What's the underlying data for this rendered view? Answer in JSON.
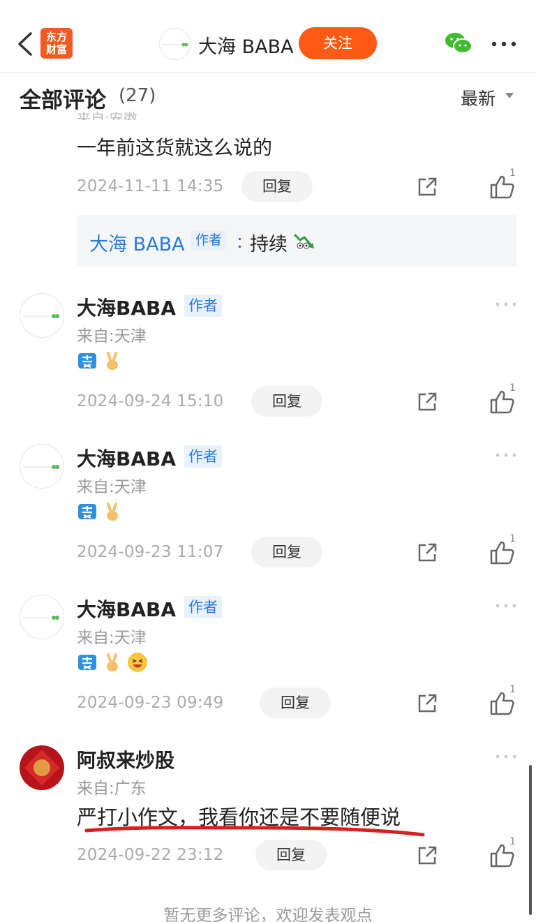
{
  "nav": {
    "logo_line1": "东方",
    "logo_line2": "财富",
    "author_name": "大海 BABA",
    "follow_label": "关注"
  },
  "header": {
    "title": "全部评论",
    "count": "(27)",
    "sort_label": "最新"
  },
  "partial_comment": {
    "source": "来自:安徽",
    "text": "一年前这货就这么说的",
    "time": "2024-11-11 14:35",
    "reply_label": "回复",
    "like_count": "1",
    "sub_reply": {
      "name": "大海 BABA",
      "tag": "作者",
      "colon": "：",
      "text": "持续"
    }
  },
  "comments": [
    {
      "name": "大海BABA",
      "tag": "作者",
      "source": "来自:天津",
      "emojis": [
        "sell-emoji",
        "victory-hand-emoji"
      ],
      "time": "2024-09-24 15:10",
      "reply_label": "回复",
      "like_count": "1"
    },
    {
      "name": "大海BABA",
      "tag": "作者",
      "source": "来自:天津",
      "emojis": [
        "sell-emoji",
        "victory-hand-emoji"
      ],
      "time": "2024-09-23 11:07",
      "reply_label": "回复",
      "like_count": "1"
    },
    {
      "name": "大海BABA",
      "tag": "作者",
      "source": "来自:天津",
      "emojis": [
        "sell-emoji",
        "victory-hand-emoji",
        "laughing-face-emoji"
      ],
      "time": "2024-09-23 09:49",
      "reply_label": "回复",
      "like_count": "1"
    },
    {
      "name": "阿叔来炒股",
      "tag": "",
      "source": "来自:广东",
      "text": "严打小作文，我看你还是不要随便说",
      "time": "2024-09-22 23:12",
      "reply_label": "回复",
      "like_count": "1"
    }
  ],
  "footer": {
    "tip": "暂无更多评论，欢迎发表观点"
  },
  "colors": {
    "accent": "#ff5a14",
    "author_blue": "#2b7bd8",
    "underline_red": "#d81e1e"
  }
}
